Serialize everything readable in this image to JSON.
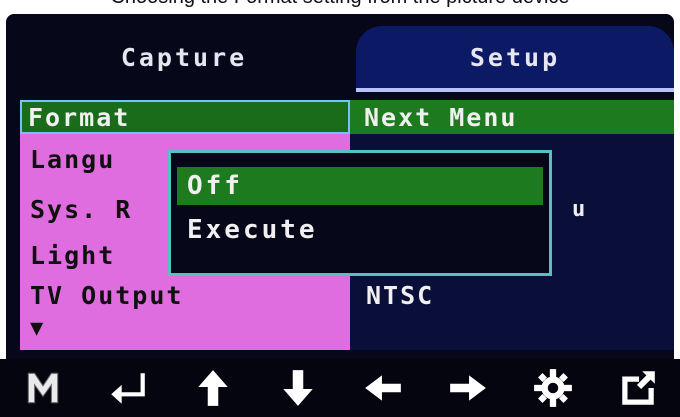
{
  "caption": "Choosing the Format setting from the picture device",
  "tabs": [
    {
      "label": "Capture"
    },
    {
      "label": "Setup"
    }
  ],
  "menu": {
    "format": "Format",
    "next_menu": "Next Menu",
    "language": "Langu",
    "sys_res": "Sys. R",
    "light": "Light",
    "tv_output": "TV Output",
    "ntsc": "NTSC",
    "value_dot": "u",
    "down_indicator": "▼"
  },
  "popup": {
    "off": "Off",
    "execute": "Execute"
  },
  "bottom_icons": [
    "m-icon",
    "enter-icon",
    "up-arrow-icon",
    "down-arrow-icon",
    "left-arrow-icon",
    "right-arrow-icon",
    "gear-icon",
    "export-icon"
  ],
  "colors": {
    "selected": "#1e7a1e",
    "left_panel": "#e06de0",
    "tab_active": "#0c1a66",
    "popup_border": "#58c0c0"
  }
}
